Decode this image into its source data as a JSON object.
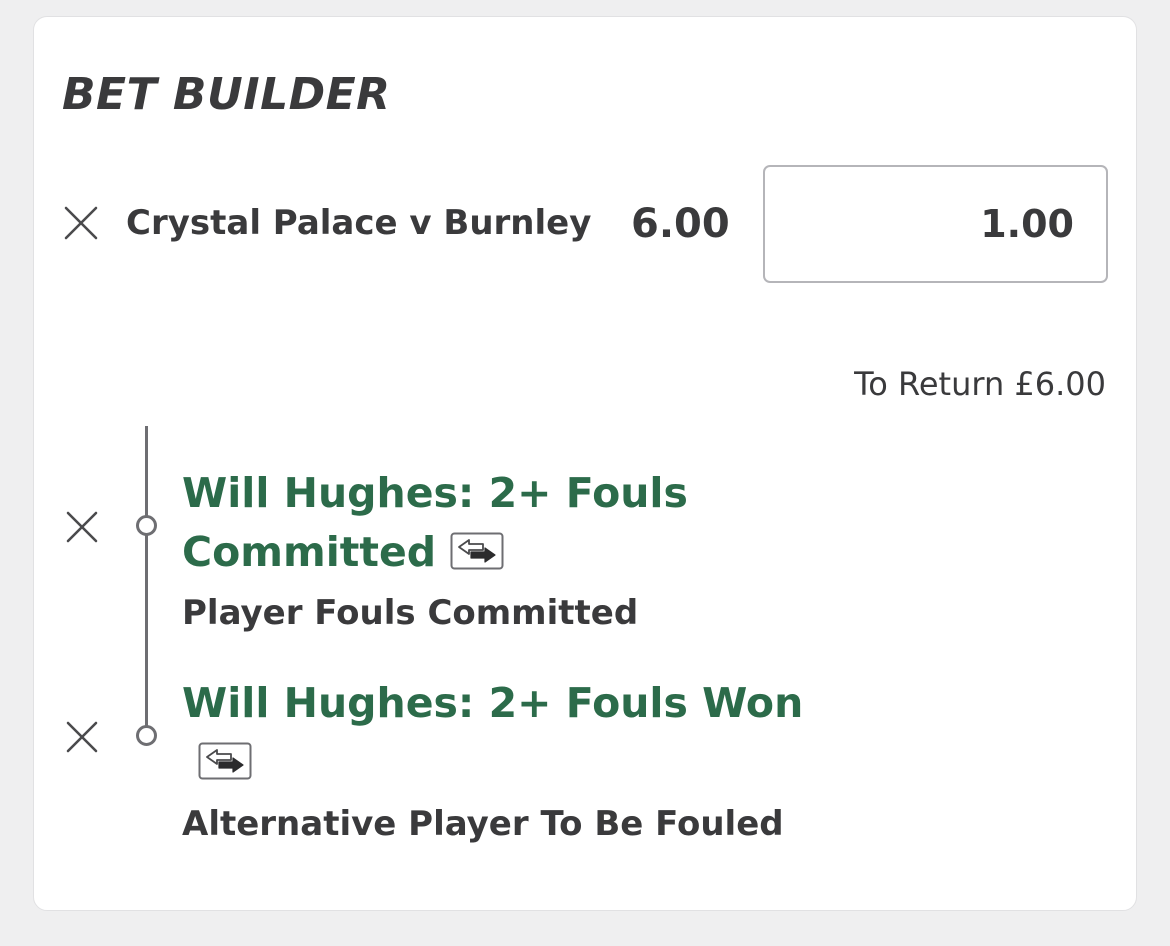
{
  "bet_builder": {
    "title": "BET BUILDER",
    "event": {
      "name": "Crystal Palace v Burnley",
      "odds": "6.00",
      "stake": "1.00"
    },
    "to_return": "To Return £6.00",
    "selections": [
      {
        "title": "Will Hughes: 2+ Fouls Committed",
        "market": "Player Fouls Committed"
      },
      {
        "title": "Will Hughes: 2+ Fouls Won",
        "market": "Alternative Player To Be Fouled"
      }
    ]
  },
  "colors": {
    "background": "#efeff0",
    "card": "#ffffff",
    "text": "#3a3a3c",
    "selection_green": "#2c6b4a",
    "timeline": "#6e6e72",
    "input_border": "#b5b5b9"
  },
  "icons": {
    "remove": "close-icon",
    "swap": "swap-arrows-icon"
  }
}
